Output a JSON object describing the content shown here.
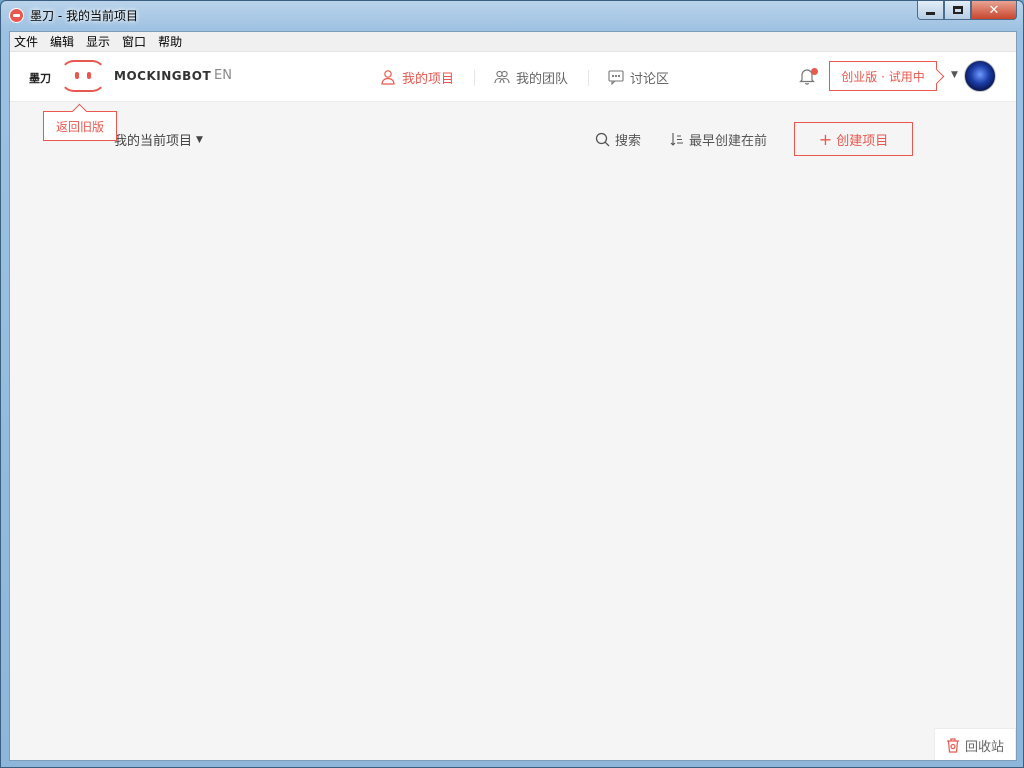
{
  "window": {
    "title": "墨刀 - 我的当前项目",
    "close_glyph": "✕"
  },
  "menu": [
    "文件",
    "编辑",
    "显示",
    "窗口",
    "帮助"
  ],
  "header": {
    "brand_cn": "墨刀",
    "brand_en": "MOCKINGBOT",
    "lang": "EN",
    "nav": [
      {
        "label": "我的项目",
        "icon": "user-icon",
        "active": true
      },
      {
        "label": "我的团队",
        "icon": "team-icon",
        "active": false
      },
      {
        "label": "讨论区",
        "icon": "chat-icon",
        "active": false
      }
    ],
    "plan_badge": "创业版 · 试用中",
    "accent_color": "#e8584f"
  },
  "old_version_tip": "返回旧版",
  "toolbar": {
    "project_select": "我的当前项目",
    "search_label": "搜索",
    "sort_label": "最早创建在前",
    "create_label": "创建项目",
    "create_plus": "+"
  },
  "recycle_label": "回收站"
}
